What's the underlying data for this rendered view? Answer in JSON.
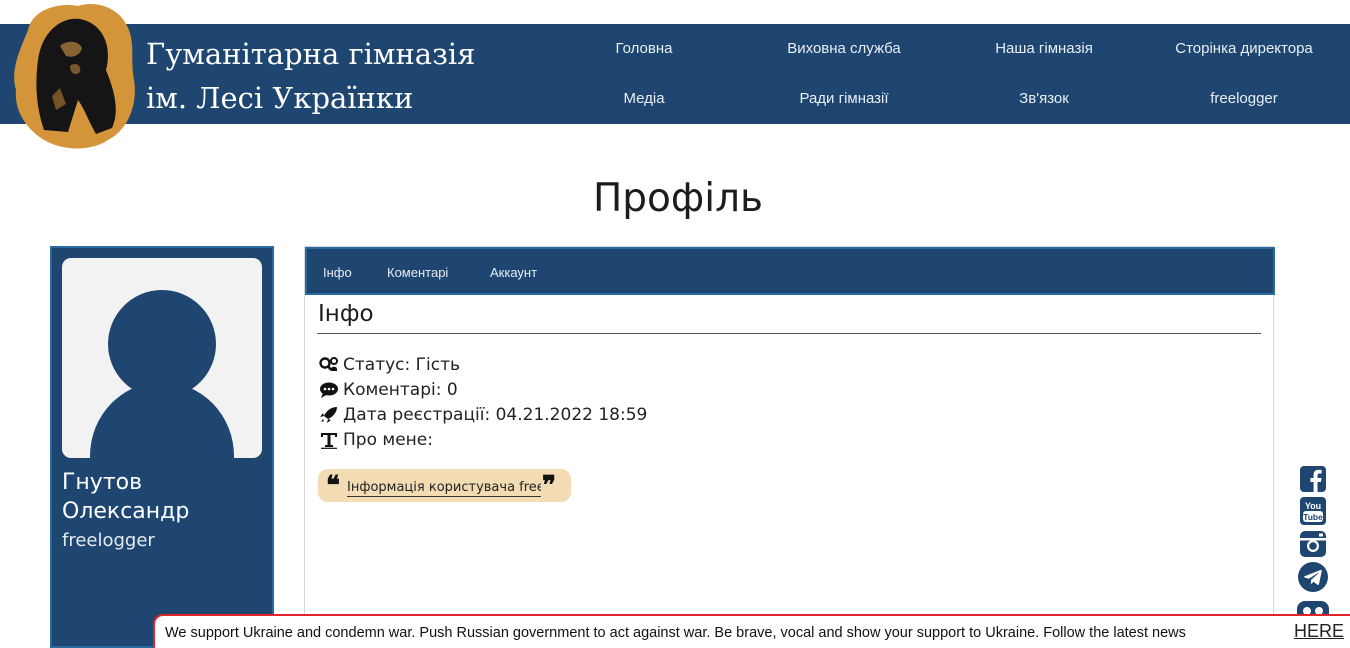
{
  "site": {
    "title_line1": "Гуманітарна гімназія",
    "title_line2": "ім. Лесі Українки",
    "brand_color": "#1e4670",
    "logo_color": "#d4943a"
  },
  "nav": {
    "items": [
      {
        "label": "Головна"
      },
      {
        "label": "Виховна служба"
      },
      {
        "label": "Наша гімназія"
      },
      {
        "label": "Сторінка директора"
      },
      {
        "label": "Медіа"
      },
      {
        "label": "Ради гімназії"
      },
      {
        "label": "Зв'язок"
      },
      {
        "label": "freelogger"
      }
    ]
  },
  "page": {
    "title": "Профіль"
  },
  "profile": {
    "name": "Гнутов Олександр",
    "login": "freelogger"
  },
  "tabs": [
    {
      "label": "Інфо"
    },
    {
      "label": "Коментарі"
    },
    {
      "label": "Аккаунт"
    }
  ],
  "info": {
    "title": "Інфо",
    "status": "Статус: Гість",
    "comments": "Коментарі: 0",
    "registered": "Дата реєстрації: 04.21.2022 18:59",
    "about": "Про мене:",
    "quote": "Інформація користувача freelogger",
    "quote_bg": "#f3dcb4"
  },
  "social": [
    "facebook-icon",
    "youtube-icon",
    "instagram-icon",
    "telegram-icon",
    "viber-icon"
  ],
  "banner": {
    "text": "We support Ukraine and condemn war. Push Russian government to act against war. Be brave, vocal and show your support to Ukraine. Follow the latest news",
    "link": "HERE",
    "border_color": "#e0242a"
  }
}
